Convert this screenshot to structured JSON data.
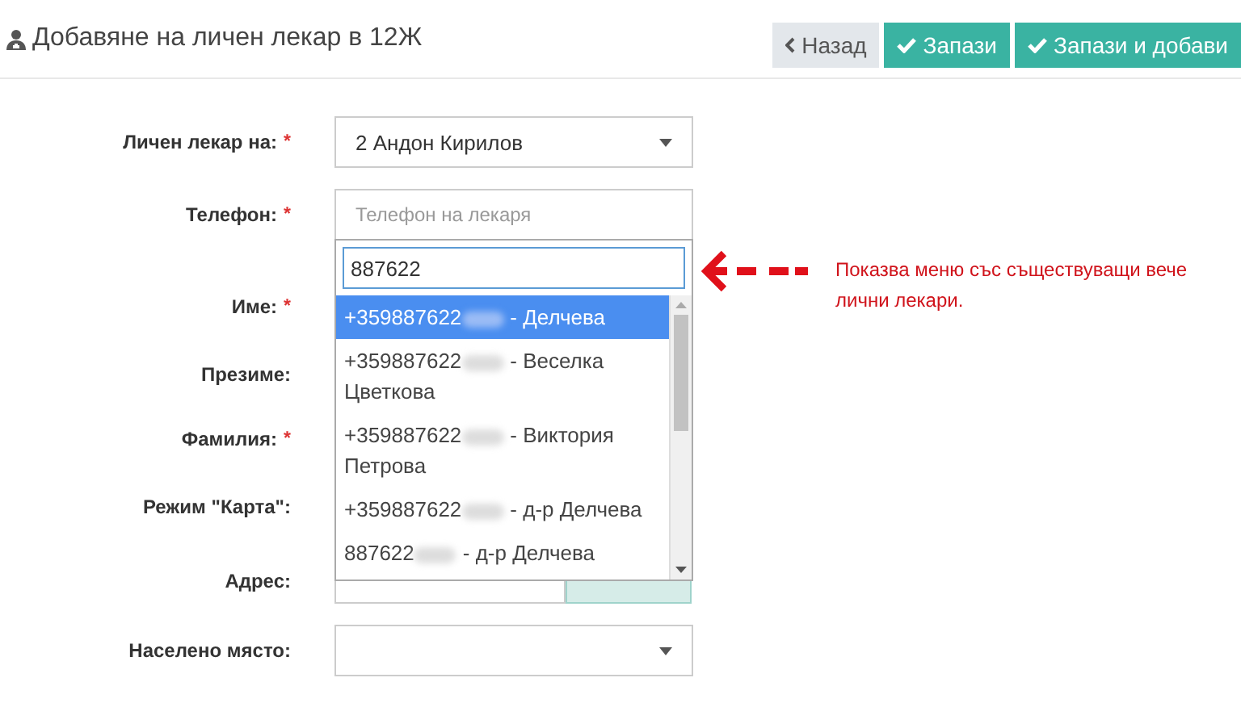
{
  "header": {
    "title": "Добавяне на личен лекар в 12Ж"
  },
  "actions": [
    {
      "label": "Назад",
      "kind": "back"
    },
    {
      "label": "Запази",
      "kind": "save"
    },
    {
      "label": "Запази и добави",
      "kind": "save"
    }
  ],
  "form": [
    {
      "label": "Личен лекар на:",
      "mark": "*",
      "kind": "select",
      "value": "2 Андон Кирилов"
    },
    {
      "label": "Телефон:",
      "mark": "*",
      "kind": "text",
      "placeholder": "Телефон на лекаря"
    },
    {
      "label": "Име:",
      "mark": "*",
      "kind": "covered"
    },
    {
      "label": "Презиме:",
      "kind": "covered"
    },
    {
      "label": "Фамилия:",
      "mark": "*",
      "kind": "covered"
    },
    {
      "label": "Режим \"Карта\":",
      "kind": "covered"
    },
    {
      "label": "Адрес:",
      "kind": "search"
    },
    {
      "label": "Населено място:",
      "kind": "select"
    }
  ],
  "dropdown": {
    "search_value": "887622",
    "options": [
      {
        "number": "+359887622",
        "name": "- Делчева",
        "redacted": true,
        "selected": true
      },
      {
        "number": "+359887622",
        "name": "- Веселка Цветкова",
        "redacted": true,
        "selected": false
      },
      {
        "number": "+359887622",
        "name": "- Виктория Петрова",
        "redacted": true,
        "selected": false
      },
      {
        "number": "+359887622",
        "name": "- д-р Делчева",
        "redacted": true,
        "selected": false
      },
      {
        "number": "887622",
        "name": "- д-р Делчева",
        "redacted": true,
        "selected": false
      }
    ]
  },
  "annotation": {
    "text": "Показва меню със съществуващи вече лични лекари."
  }
}
